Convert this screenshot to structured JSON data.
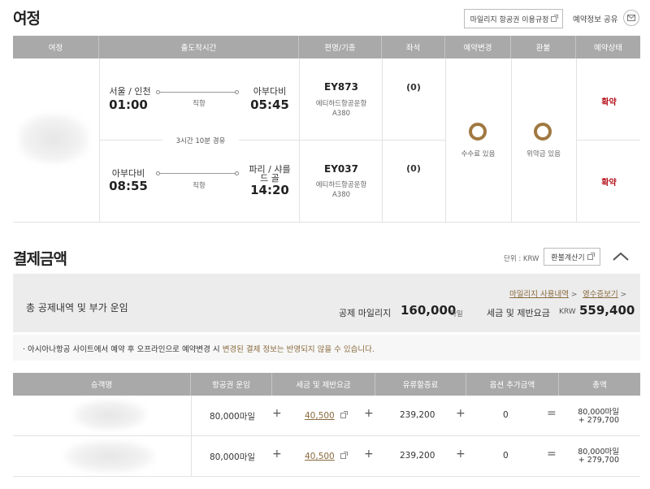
{
  "itinerary": {
    "title": "여정",
    "mileage_rules_btn": "마일리지 항공권 이용규정",
    "share_label": "예약정보 공유",
    "headers": [
      "여정",
      "출도착시간",
      "편명/기종",
      "좌석",
      "예약변경",
      "환불",
      "예약상태"
    ],
    "segments": [
      {
        "dep_city": "서울 / 인천",
        "dep_time": "01:00",
        "arr_city": "아부다비",
        "arr_time": "05:45",
        "route_type": "직항",
        "flight_no": "EY873",
        "carrier": "에티하드항공운항",
        "aircraft": "A380",
        "seat": "(0)",
        "status": "확약"
      },
      {
        "dep_city": "아부다비",
        "dep_time": "08:55",
        "arr_city_line1": "파리 / 샤를",
        "arr_city_line2": "드 골",
        "arr_time": "14:20",
        "route_type": "직항",
        "flight_no": "EY037",
        "carrier": "에티하드항공운항",
        "aircraft": "A380",
        "seat": "(0)",
        "status": "확약"
      }
    ],
    "layover": "3시간 10분 경유",
    "change_fee": "수수료 있음",
    "refund_fee": "위약금 있음"
  },
  "payment": {
    "title": "결제금액",
    "unit": "단위 : KRW",
    "refund_calc_btn": "환불계산기",
    "summary_label": "총 공제내역 및 부가 운임",
    "mileage_history_link": "마일리지 사용내역",
    "receipt_link": "영수증보기",
    "deducted_label": "공제 마일리지",
    "deducted_value": "160,000",
    "deducted_unit": "마일",
    "tax_label": "세금 및 제반요금",
    "tax_currency": "KRW",
    "tax_value": "559,400",
    "notice_prefix": "아시아나항공 사이트에서 예약 후 오프라인으로 예약변경 시 ",
    "notice_highlight": "변경된 결제 정보는 반영되지 않을 수 있습니다."
  },
  "passengers": {
    "headers": [
      "승객명",
      "항공권 운임",
      "세금 및 제반요금",
      "유류할증료",
      "옵션 추가금액",
      "총액"
    ],
    "rows": [
      {
        "fare": "80,000마일",
        "tax": "40,500",
        "fuel": "239,200",
        "option": "0",
        "total_line1": "80,000마일",
        "total_line2": "+ 279,700"
      },
      {
        "fare": "80,000마일",
        "tax": "40,500",
        "fuel": "239,200",
        "option": "0",
        "total_line1": "80,000마일",
        "total_line2": "+ 279,700"
      }
    ],
    "plus": "+",
    "equals": "="
  }
}
